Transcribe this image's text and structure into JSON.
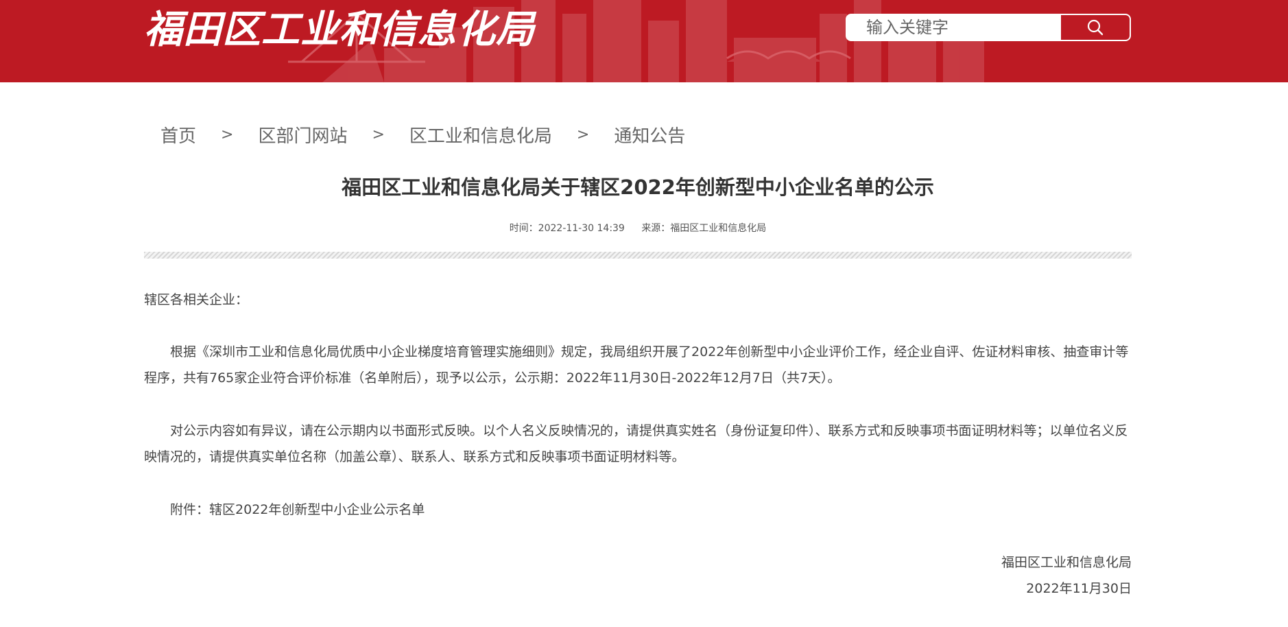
{
  "header": {
    "site_title": "福田区工业和信息化局",
    "search_placeholder": "输入关键字",
    "search_icon": "search-icon",
    "brand_color": "#bd1a23"
  },
  "breadcrumb": {
    "items": [
      "首页",
      "区部门网站",
      "区工业和信息化局",
      "通知公告"
    ],
    "separator": ">"
  },
  "article": {
    "title": "福田区工业和信息化局关于辖区2022年创新型中小企业名单的公示",
    "time_label": "时间：2022-11-30 14:39",
    "source_label": "来源：福田区工业和信息化局",
    "greeting": "辖区各相关企业：",
    "paragraphs": [
      "根据《深圳市工业和信息化局优质中小企业梯度培育管理实施细则》规定，我局组织开展了2022年创新型中小企业评价工作，经企业自评、佐证材料审核、抽查审计等程序，共有765家企业符合评价标准（名单附后），现予以公示，公示期：2022年11月30日-2022年12月7日（共7天）。",
      "对公示内容如有异议，请在公示期内以书面形式反映。以个人名义反映情况的，请提供真实姓名（身份证复印件）、联系方式和反映事项书面证明材料等；以单位名义反映情况的，请提供真实单位名称（加盖公章）、联系人、联系方式和反映事项书面证明材料等。"
    ],
    "attachment_label": "附件：",
    "attachment_link": "辖区2022年创新型中小企业公示名单",
    "signature_org": "福田区工业和信息化局",
    "signature_date": "2022年11月30日"
  }
}
